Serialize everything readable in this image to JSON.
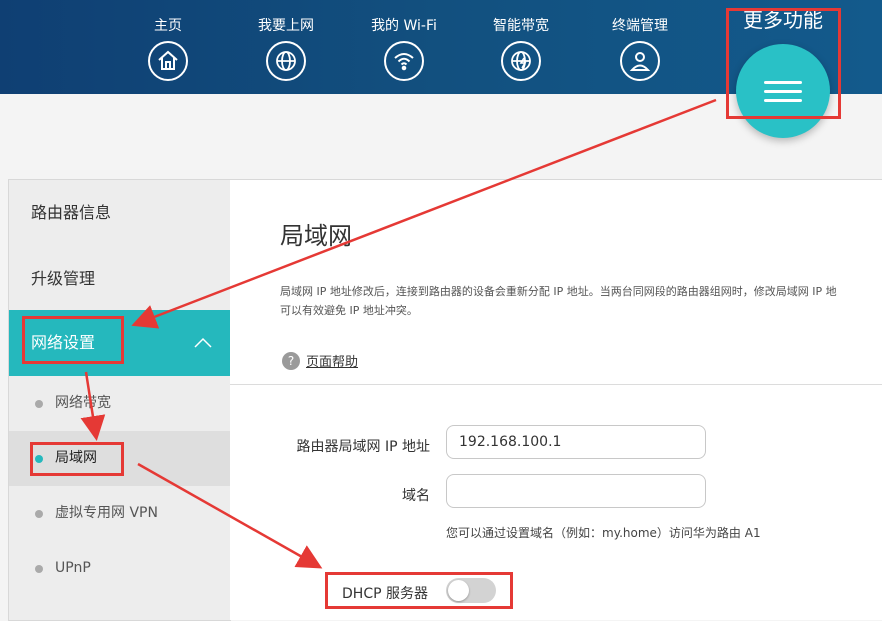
{
  "nav": {
    "items": [
      {
        "label": "主页",
        "icon": "home-icon"
      },
      {
        "label": "我要上网",
        "icon": "globe-icon"
      },
      {
        "label": "我的 Wi-Fi",
        "icon": "wifi-icon"
      },
      {
        "label": "智能带宽",
        "icon": "bandwidth-icon"
      },
      {
        "label": "终端管理",
        "icon": "user-icon"
      }
    ],
    "more_label": "更多功能",
    "more_icon": "menu-icon"
  },
  "sidebar": {
    "items": [
      "路由器信息",
      "升级管理",
      "网络设置"
    ],
    "sub_items": [
      "网络带宽",
      "局域网",
      "虚拟专用网 VPN",
      "UPnP"
    ]
  },
  "main": {
    "title": "局域网",
    "description_line1": "局域网 IP 地址修改后，连接到路由器的设备会重新分配 IP 地址。当两台同网段的路由器组网时，修改局域网 IP 地",
    "description_line2": "可以有效避免 IP 地址冲突。",
    "help_label": "页面帮助",
    "ip_label": "路由器局域网 IP 地址",
    "ip_value": "192.168.100.1",
    "domain_label": "域名",
    "domain_value": "",
    "domain_hint": "您可以通过设置域名（例如：my.home）访问华为路由 A1",
    "dhcp_label": "DHCP 服务器",
    "dhcp_enabled": false
  },
  "colors": {
    "header": "#12507f",
    "accent": "#25b8bd",
    "annotation": "#e53935"
  }
}
